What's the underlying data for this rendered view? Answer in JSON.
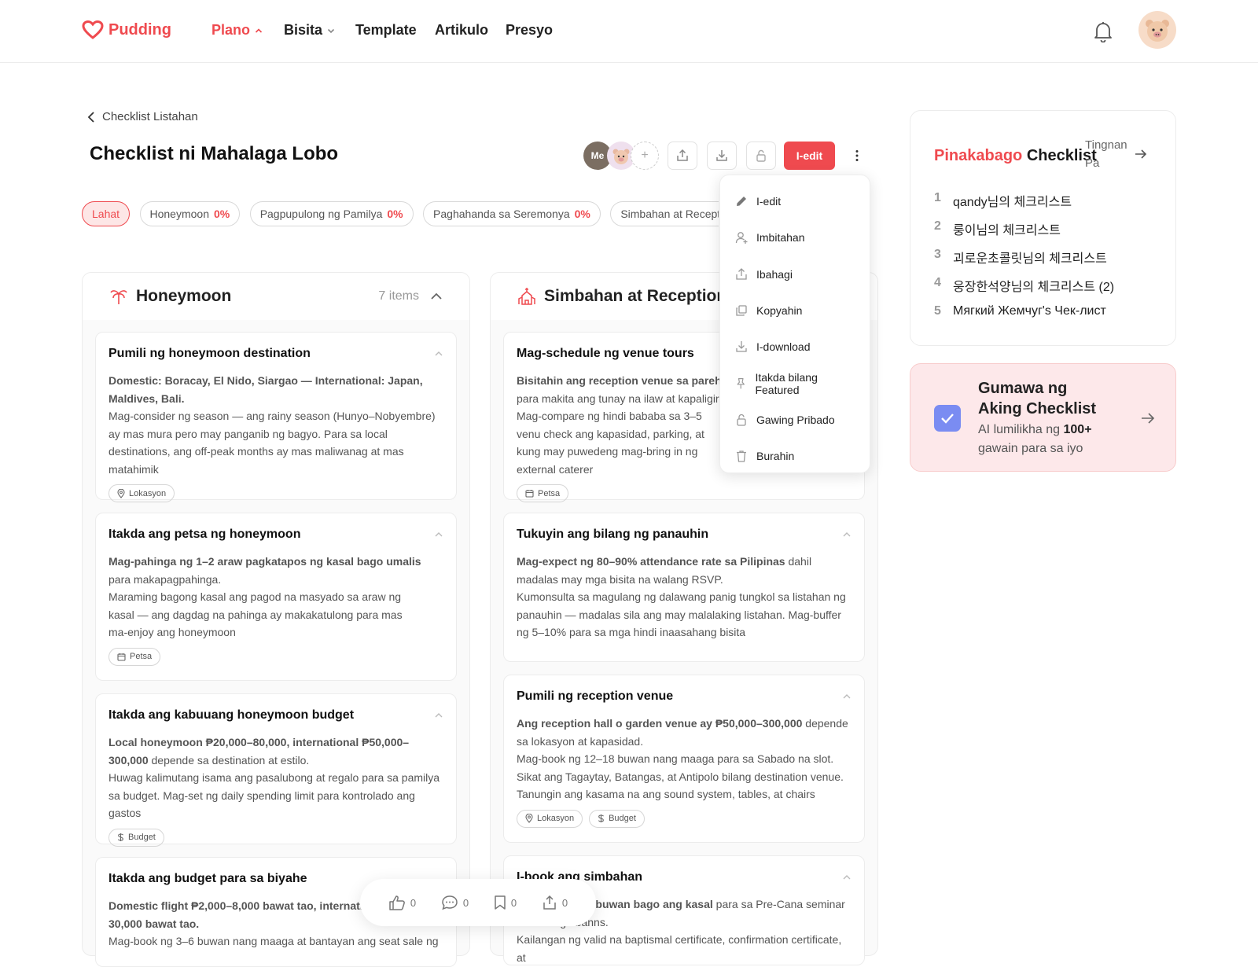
{
  "brand": "Pudding",
  "nav": [
    {
      "label": "Plano",
      "active": true,
      "caret": "up"
    },
    {
      "label": "Bisita",
      "active": false,
      "caret": "down"
    },
    {
      "label": "Template",
      "active": false
    },
    {
      "label": "Artikulo",
      "active": false
    },
    {
      "label": "Presyo",
      "active": false
    }
  ],
  "page": {
    "back_label": "Checklist Listahan",
    "title": "Checklist ni Mahalaga Lobo",
    "collaborator_me": "Me",
    "add_collaborator": "+",
    "edit_label": "I-edit"
  },
  "filters": [
    {
      "label": "Lahat",
      "active": true,
      "pct": ""
    },
    {
      "label": "Honeymoon",
      "active": false,
      "pct": "0%"
    },
    {
      "label": "Pagpupulong ng Pamilya",
      "active": false,
      "pct": "0%"
    },
    {
      "label": "Paghahanda sa Seremonya",
      "active": false,
      "pct": "0%"
    },
    {
      "label": "Simbahan at Reception Ven",
      "active": false,
      "pct": ""
    }
  ],
  "columns": [
    {
      "title": "Honeymoon",
      "count": "7 items",
      "cards": [
        {
          "title": "Pumili ng honeymoon destination",
          "bold": "Domestic: Boracay, El Nido, Siargao — International: Japan, Maldives, Bali.",
          "text": "Mag-consider ng season — ang rainy season (Hunyo–Nobyembre) ay mas mura pero may panganib ng bagyo. Para sa local destinations, ang off-peak months ay mas maliwanag at mas matahimik",
          "tags": [
            "Lokasyon"
          ]
        },
        {
          "title": "Itakda ang petsa ng honeymoon",
          "bold": "Mag-pahinga ng 1–2 araw pagkatapos ng kasal bago umalis",
          "text_inline": "para makapagpahinga.",
          "text": "Maraming bagong kasal ang pagod na masyado sa araw ng kasal — ang dagdag na pahinga ay makakatulong para mas ma-enjoy ang honeymoon",
          "tags": [
            "Petsa"
          ]
        },
        {
          "title": "Itakda ang kabuuang honeymoon budget",
          "bold": "Local honeymoon ₱20,000–80,000, international ₱50,000–300,000",
          "text_inline": "depende sa destination at estilo.",
          "text": "Huwag kalimutang isama ang pasalubong at regalo para sa pamilya sa budget. Mag-set ng daily spending limit para kontrolado ang gastos",
          "tags": [
            "Budget"
          ]
        },
        {
          "title": "Itakda ang budget para sa biyahe",
          "bold": "Domestic flight ₱2,000–8,000 bawat tao, internation",
          "text_inline": "30,000 bawat tao.",
          "text": "Mag-book ng 3–6 buwan nang maaga at bantayan ang seat sale ng",
          "tags": []
        }
      ]
    },
    {
      "title": "Simbahan at Reception Ve",
      "count": "",
      "cards": [
        {
          "title": "Mag-schedule ng venue tours",
          "bold": "Bisitahin ang reception venue sa parehong",
          "text_inline": "para makita ang tunay na ilaw at kapaligiran",
          "text": "Mag-compare ng hindi bababa sa 3–5 venu check ang kapasidad, parking, at kung may puwedeng mag-bring in ng external caterer",
          "tags": [
            "Petsa"
          ]
        },
        {
          "title": "Tukuyin ang bilang ng panauhin",
          "bold": "Mag-expect ng 80–90% attendance rate sa Pilipinas",
          "text_inline": "dahil madalas may mga bisita na walang RSVP.",
          "text": "Kumonsulta sa magulang ng dalawang panig tungkol sa listahan ng panauhin — madalas sila ang may malalaking listahan. Mag-buffer ng 5–10% para sa mga hindi inaasahang bisita",
          "tags": []
        },
        {
          "title": "Pumili ng reception venue",
          "bold": "Ang reception hall o garden venue ay ₱50,000–300,000",
          "text_inline": "depende sa lokasyon at kapasidad.",
          "text": "Mag-book ng 12–18 buwan nang maaga para sa Sabado na slot. Sikat ang Tagaytay, Batangas, at Antipolo bilang destination venue. Tanungin ang kasama na ang sound system, tables, at chairs",
          "tags": [
            "Lokasyon",
            "Budget"
          ]
        },
        {
          "title": "I-book ang simbahan",
          "bold": "sa parish 6–12 buwan bago ang kasal",
          "text_inline": "para sa Pre-Cana seminar at marriage banns.",
          "text": "Kailangan ng valid na baptismal certificate, confirmation certificate, at",
          "tags": []
        }
      ]
    }
  ],
  "menu": [
    {
      "label": "I-edit",
      "icon": "pencil-icon"
    },
    {
      "label": "Imbitahan",
      "icon": "user-plus-icon"
    },
    {
      "label": "Ibahagi",
      "icon": "share-icon"
    },
    {
      "label": "Kopyahin",
      "icon": "copy-icon"
    },
    {
      "label": "I-download",
      "icon": "download-icon"
    },
    {
      "label": "Itakda bilang Featured",
      "icon": "pin-icon"
    },
    {
      "label": "Gawing Pribado",
      "icon": "lock-icon"
    },
    {
      "label": "Burahin",
      "icon": "trash-icon"
    }
  ],
  "popular": {
    "title_red": "Pinakabago",
    "title_rest": "Checklist",
    "more": "Tingnan Pa",
    "items": [
      {
        "n": "1",
        "label": "qandy님의 체크리스트"
      },
      {
        "n": "2",
        "label": "룽이님의 체크리스트"
      },
      {
        "n": "3",
        "label": "괴로운초콜릿님의 체크리스트"
      },
      {
        "n": "4",
        "label": "웅장한석양님의 체크리스트 (2)"
      },
      {
        "n": "5",
        "label": "Мягкий Жемчуг's Чек-лист"
      }
    ]
  },
  "create": {
    "title": "Gumawa ng Aking Checklist",
    "sub_prefix": "AI lumilikha ng",
    "sub_bold": "100+",
    "sub_suffix": "gawain para sa iyo"
  },
  "actions": {
    "likes": "0",
    "comments": "0",
    "bookmarks": "0",
    "shares": "0"
  },
  "colors": {
    "accent": "#ef4a4f",
    "check": "#7a8cf2"
  }
}
